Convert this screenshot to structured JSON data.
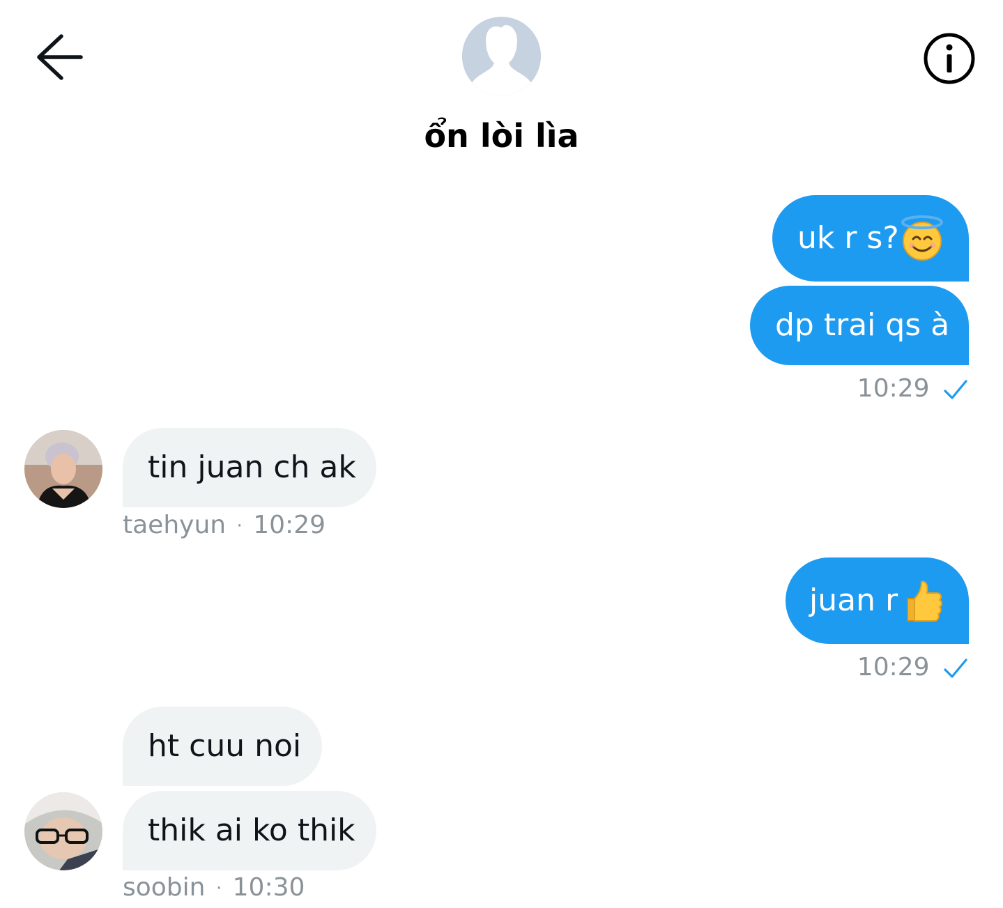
{
  "header": {
    "title": "ổn lòi lìa",
    "back_icon": "arrow-left-icon",
    "info_icon": "info-icon",
    "group_avatar_icon": "default-avatar-icon"
  },
  "messages": [
    {
      "direction": "sent",
      "text": "uk r s?",
      "emoji": "smiling-face-with-halo"
    },
    {
      "direction": "sent",
      "text": "dp trai qs à"
    },
    {
      "direction": "sent-meta",
      "time": "10:29",
      "status_icon": "check-icon"
    },
    {
      "direction": "received",
      "text": "tin juan ch ak"
    },
    {
      "direction": "received-meta",
      "sender": "taehyun",
      "separator": "·",
      "time": "10:29"
    },
    {
      "direction": "sent",
      "text": "juan r",
      "emoji": "thumbs-up"
    },
    {
      "direction": "sent-meta",
      "time": "10:29",
      "status_icon": "check-icon"
    },
    {
      "direction": "received",
      "text": "ht cuu noi"
    },
    {
      "direction": "received",
      "text": "thik ai ko thik"
    },
    {
      "direction": "received-meta",
      "sender": "soobin",
      "separator": "·",
      "time": "10:30"
    }
  ],
  "colors": {
    "sent_bubble": "#1d9bf0",
    "received_bubble": "#eff3f4",
    "meta_text": "#8a9299",
    "check": "#1d9bf0"
  }
}
